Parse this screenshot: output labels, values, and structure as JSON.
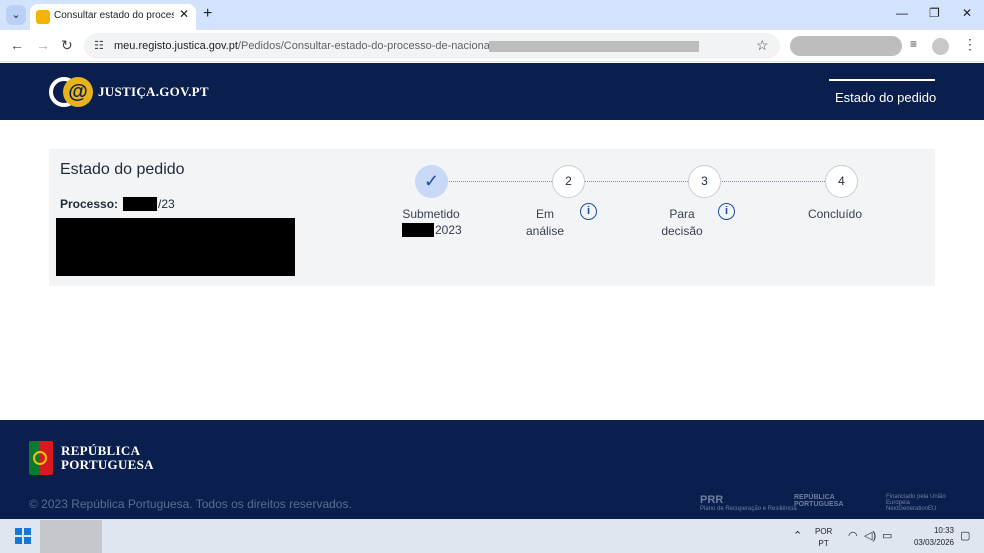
{
  "browser": {
    "tab_list_icon": "chevron-down-icon",
    "tab_title": "Consultar estado do processo de nacionalidade",
    "tab_close": "✕",
    "new_tab": "+",
    "window_minimize": "—",
    "window_restore": "❐",
    "window_close": "✕",
    "url_domain": "meu.registo.justica.gov.pt",
    "url_path": "/Pedidos/Consultar-estado-do-processo-de-nacionalidade"
  },
  "header": {
    "brand": "JUSTIÇA.GOV.PT",
    "nav_active": "Estado do pedido"
  },
  "card": {
    "title": "Estado do pedido",
    "process_label": "Processo:",
    "process_suffix": "/23"
  },
  "steps": [
    {
      "number": "✓",
      "label": "Submetido",
      "date_suffix": "2023",
      "status": "done"
    },
    {
      "number": "2",
      "label_line1": "Em",
      "label_line2": "análise",
      "has_info": true,
      "status": "pending"
    },
    {
      "number": "3",
      "label_line1": "Para",
      "label_line2": "decisão",
      "has_info": true,
      "status": "pending"
    },
    {
      "number": "4",
      "label": "Concluído",
      "status": "pending"
    }
  ],
  "footer": {
    "rep_line1": "REPÚBLICA",
    "rep_line2": "PORTUGUESA",
    "copyright": "© 2023 República Portuguesa. Todos os direitos reservados.",
    "logo_prr": "PRR",
    "logo_prr_sub": "Plano de Recuperação e Resiliência",
    "logo_rep": "REPÚBLICA PORTUGUESA",
    "logo_eu": "Financiado pela União Europeia NextGenerationEU"
  },
  "taskbar": {
    "lang_line1": "POR",
    "lang_line2": "PT",
    "time": "10:33",
    "date": "03/03/2026"
  },
  "colors": {
    "header_bg": "#0b1f4f",
    "accent_gold": "#e8b21b",
    "step_done": "#c8d8f6",
    "info_blue": "#1b4ea8"
  }
}
